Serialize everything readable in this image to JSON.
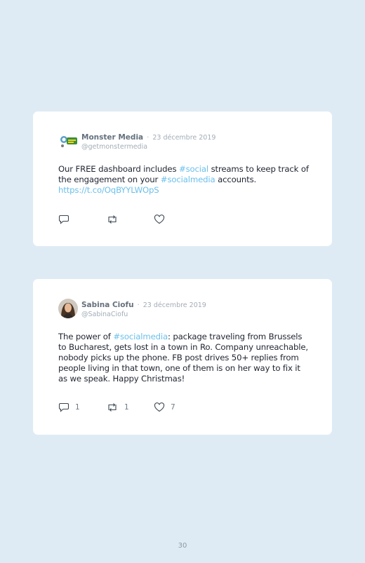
{
  "tweets": [
    {
      "author": "Monster Media",
      "date": "23 décembre 2019",
      "handle": "@getmonstermedia",
      "text_parts": [
        {
          "text": "Our FREE dashboard includes ",
          "tag": false
        },
        {
          "text": "#social",
          "tag": true
        },
        {
          "text": " streams to keep track of the engagement on your ",
          "tag": false
        },
        {
          "text": "#socialmedia",
          "tag": true
        },
        {
          "text": " accounts. ",
          "tag": false
        },
        {
          "text": "https://t.co/OqBYYLWOpS",
          "tag": true
        }
      ],
      "replies": "",
      "retweets": "",
      "likes": ""
    },
    {
      "author": "Sabina Ciofu",
      "date": "23 décembre 2019",
      "handle": "@SabinaCiofu",
      "text_parts": [
        {
          "text": "The power of ",
          "tag": false
        },
        {
          "text": "#socialmedia",
          "tag": true
        },
        {
          "text": ": package traveling from Brussels to Bucharest, gets lost in a town in Ro. Company unreachable, nobody picks up the phone. FB post drives 50+ replies from people living in that town, one of them is on her way to fix it as we speak. Happy Christmas!",
          "tag": false
        }
      ],
      "replies": "1",
      "retweets": "1",
      "likes": "7"
    }
  ],
  "separator": "·",
  "page_number": "30",
  "colors": {
    "background": "#dfebf4",
    "card": "#ffffff",
    "hashtag": "#6bc0eb",
    "muted": "#a3adb6"
  },
  "icons": [
    "monster-media-avatar",
    "sabina-ciofu-avatar",
    "reply-icon",
    "retweet-icon",
    "like-icon"
  ]
}
